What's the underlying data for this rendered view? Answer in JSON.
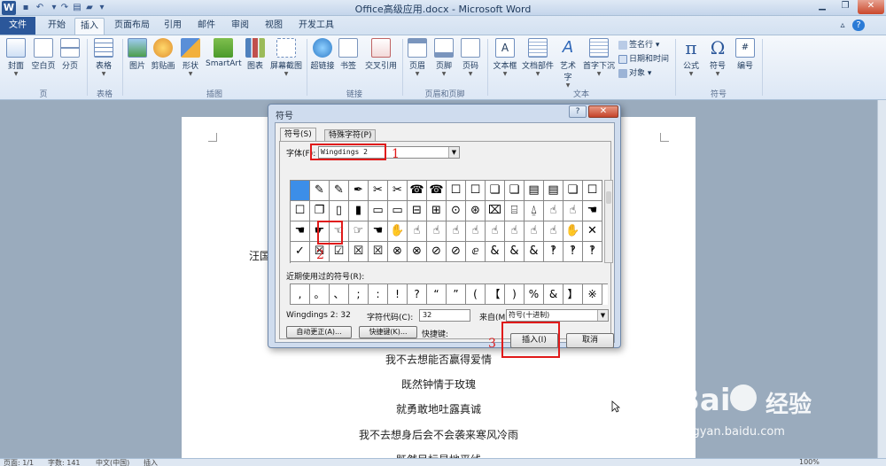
{
  "window": {
    "title": "Office高级应用.docx - Microsoft Word",
    "app_logo": "W"
  },
  "tabs": [
    {
      "label": "文件"
    },
    {
      "label": "开始"
    },
    {
      "label": "插入"
    },
    {
      "label": "页面布局"
    },
    {
      "label": "引用"
    },
    {
      "label": "邮件"
    },
    {
      "label": "审阅"
    },
    {
      "label": "视图"
    },
    {
      "label": "开发工具"
    }
  ],
  "ribbon": {
    "buttons": {
      "cover": "封面",
      "blank": "空白页",
      "pagebreak": "分页",
      "table": "表格",
      "picture": "图片",
      "clipart": "剪贴画",
      "shapes": "形状",
      "smartart": "SmartArt",
      "chart": "图表",
      "screenshot": "屏幕截图",
      "hyperlink": "超链接",
      "bookmark": "书签",
      "crossref": "交叉引用",
      "header": "页眉",
      "footer": "页脚",
      "pagenum": "页码",
      "textbox": "文本框",
      "quickparts": "文档部件",
      "wordart": "艺术字",
      "dropcap": "首字下沉",
      "sigline": "签名行",
      "datetime": "日期和时间",
      "object": "对象",
      "equation": "公式",
      "symbol": "符号",
      "number": "编号"
    },
    "groups": {
      "pages": "页",
      "tables": "表格",
      "illustrations": "插图",
      "links": "链接",
      "headerfooter": "页眉和页脚",
      "text": "文本",
      "symbols": "符号"
    }
  },
  "document": {
    "lines": [
      "汪国",
      "我不去想能否赢得爱情",
      "既然钟情于玫瑰",
      "就勇敢地吐露真诚",
      "我不去想身后会不会袭来寒风冷雨",
      "既然目标是地平线"
    ]
  },
  "status_bar": {
    "page": "页面: 1/1",
    "words": "字数: 141",
    "lang": "中文(中国)",
    "mode": "插入",
    "zoom": "100%"
  },
  "watermark": {
    "brand": "Bai",
    "brand2": "经验",
    "url": "jingyan.baidu.com"
  },
  "dialog": {
    "title": "符号",
    "help": "?",
    "close": "✕",
    "tab_symbols": "符号(S)",
    "tab_special": "特殊字符(P)",
    "font_label": "字体(F):",
    "font_value": "Wingdings 2",
    "symbols_grid": [
      " ",
      "✎",
      "✎",
      "✒",
      "✂",
      "✂",
      "☎",
      "☎",
      "☐",
      "☐",
      "❏",
      "❏",
      "▤",
      "▤",
      "❏",
      "☐",
      "☐",
      "❐",
      "▯",
      "▮",
      "▭",
      "▭",
      "⊟",
      "⊞",
      "⊙",
      "⊛",
      "⌧",
      "⌸",
      "⍙",
      "☝",
      "☝",
      "☚",
      "☚",
      "☛",
      "☜",
      "☞",
      "☚",
      "✋",
      "☝",
      "☝",
      "☝",
      "☝",
      "☝",
      "☝",
      "☝",
      "☝",
      "✋",
      "✕",
      "✓",
      "☒",
      "☑",
      "☒",
      "☒",
      "⊗",
      "⊗",
      "⊘",
      "⊘",
      "ⅇ",
      "&",
      "&",
      "&",
      "‽",
      "‽",
      "‽"
    ],
    "recent_label": "近期使用过的符号(R):",
    "recent_symbols": [
      ",",
      "。",
      "、",
      ";",
      ":",
      "!",
      "?",
      "“",
      "”",
      "(",
      "【",
      ")",
      "%",
      "&",
      "】",
      "※"
    ],
    "char_name": "Wingdings 2: 32",
    "charcode_label": "字符代码(C):",
    "charcode_value": "32",
    "from_label": "来自(M):",
    "from_value": "符号(十进制)",
    "autocorrect_btn": "自动更正(A)...",
    "shortcut_btn": "快捷键(K)...",
    "shortcut_label": "快捷键:",
    "insert_btn": "插入(I)",
    "cancel_btn": "取消"
  },
  "annotations": {
    "n1": "1",
    "n2": "2",
    "n3": "3"
  },
  "colors": {
    "accent": "#2b579a",
    "annotation": "#e01a1a",
    "selected_cell": "#3c8ee8"
  }
}
